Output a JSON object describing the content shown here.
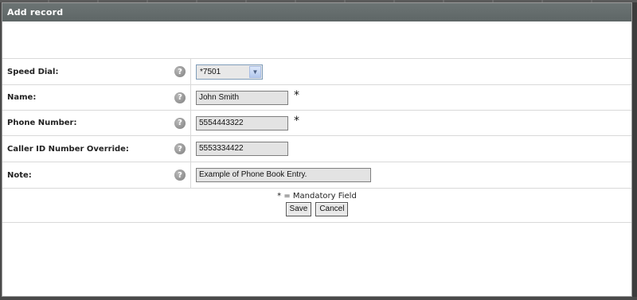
{
  "dialog": {
    "title": "Add record"
  },
  "fields": {
    "speed_dial": {
      "label": "Speed Dial:",
      "value": "*7501"
    },
    "name": {
      "label": "Name:",
      "value": "John Smith",
      "required_mark": "*"
    },
    "phone_number": {
      "label": "Phone Number:",
      "value": "5554443322",
      "required_mark": "*"
    },
    "caller_id": {
      "label": "Caller ID Number Override:",
      "value": "5553334422"
    },
    "note": {
      "label": "Note:",
      "value": "Example of Phone Book Entry."
    }
  },
  "help_icon_glyph": "?",
  "footer": {
    "mandatory_note": "* = Mandatory Field",
    "save_label": "Save",
    "cancel_label": "Cancel"
  },
  "colors": {
    "titlebar": "#646c6c",
    "input_bg": "#e3e3e3",
    "row_divider": "#d9d9d9"
  }
}
